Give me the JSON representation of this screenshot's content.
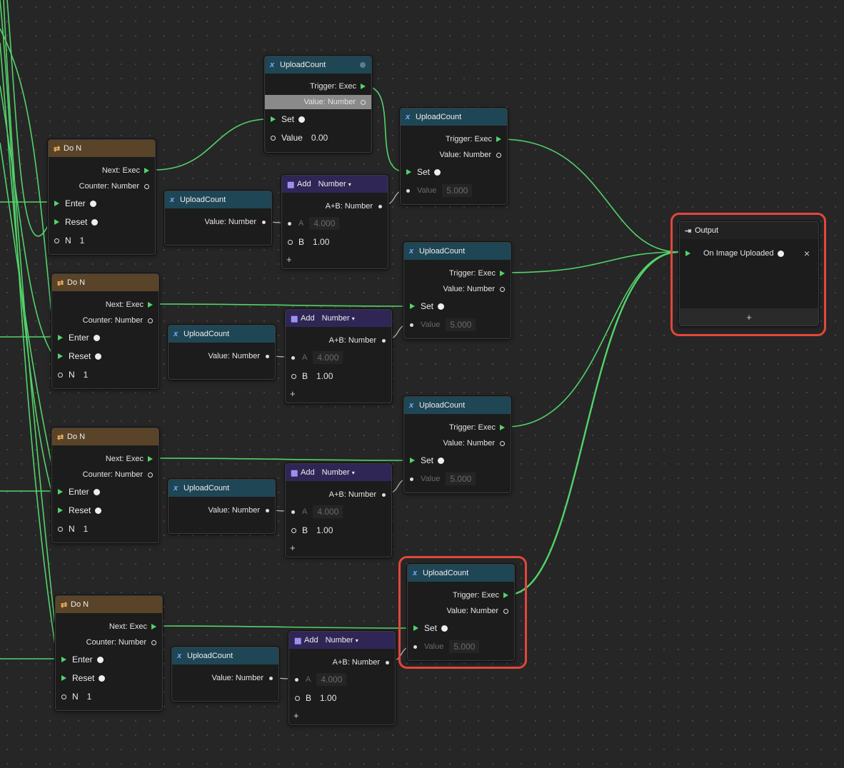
{
  "labels": {
    "upload_count": "UploadCount",
    "trigger_exec": "Trigger: Exec",
    "value_number": "Value: Number",
    "set": "Set",
    "value": "Value",
    "do_n": "Do N",
    "next_exec": "Next: Exec",
    "counter_number": "Counter: Number",
    "enter": "Enter",
    "reset": "Reset",
    "n": "N",
    "add": "Add",
    "number": "Number",
    "a_plus_b": "A+B: Number",
    "a": "A",
    "b": "B",
    "plus": "+",
    "output": "Output",
    "on_image_uploaded": "On Image Uploaded",
    "close": "×"
  },
  "values": {
    "initial_value": "0.00",
    "set_value": "5.000",
    "add_a": "4.000",
    "add_b": "1.00",
    "n_count": "1"
  },
  "colors": {
    "wire": "#53d36a",
    "highlight": "#e2473a"
  }
}
